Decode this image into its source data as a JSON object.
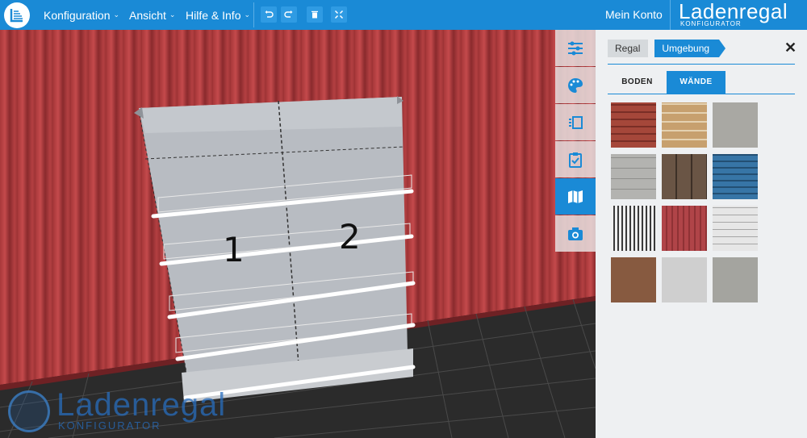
{
  "topbar": {
    "menus": [
      {
        "label": "Konfiguration",
        "chevron": "⌄"
      },
      {
        "label": "Ansicht",
        "chevron": "⌄"
      },
      {
        "label": "Hilfe & Info",
        "chevron": "⌄"
      }
    ],
    "tools": [
      "undo-icon",
      "redo-icon",
      "trash-icon",
      "fullscreen-icon"
    ],
    "account_label": "Mein Konto",
    "brand_name": "Ladenregal",
    "brand_sub": "KONFIGURATOR"
  },
  "viewport": {
    "bay_labels": [
      "1",
      "2"
    ],
    "watermark_name": "Ladenregal",
    "watermark_sub": "KONFIGURATOR"
  },
  "sidebar": {
    "buttons": [
      {
        "icon": "sliders-icon",
        "active": false
      },
      {
        "icon": "palette-icon",
        "active": false
      },
      {
        "icon": "shelf-view-icon",
        "active": false
      },
      {
        "icon": "clipboard-check-icon",
        "active": false
      },
      {
        "icon": "map-icon",
        "active": true
      },
      {
        "icon": "camera-icon",
        "active": false
      }
    ]
  },
  "panel": {
    "breadcrumb": [
      "Regal",
      "Umgebung"
    ],
    "close_label": "✕",
    "tabs": [
      {
        "label": "BODEN",
        "active": false
      },
      {
        "label": "WÄNDE",
        "active": true
      }
    ],
    "swatches": [
      {
        "name": "red-brick",
        "color": "#a5473a"
      },
      {
        "name": "sand-brick",
        "color": "#c7a06e"
      },
      {
        "name": "grey-concrete",
        "color": "#a9a8a3"
      },
      {
        "name": "grey-blocks",
        "color": "#b3b3b0"
      },
      {
        "name": "dark-wood",
        "color": "#5e4a3b"
      },
      {
        "name": "blue-planks",
        "color": "#2f6896"
      },
      {
        "name": "striped",
        "color": "#d8d8d8"
      },
      {
        "name": "red-metal",
        "color": "#b04448"
      },
      {
        "name": "white-bricks",
        "color": "#e0e0e0"
      },
      {
        "name": "brown-plain",
        "color": "#875a40"
      },
      {
        "name": "light-grey",
        "color": "#cfcfcf"
      },
      {
        "name": "grey-stone",
        "color": "#a4a49f"
      }
    ]
  },
  "colors": {
    "accent": "#1a8ad6",
    "wall": "#b04448",
    "panel_bg": "#eef0f2"
  }
}
